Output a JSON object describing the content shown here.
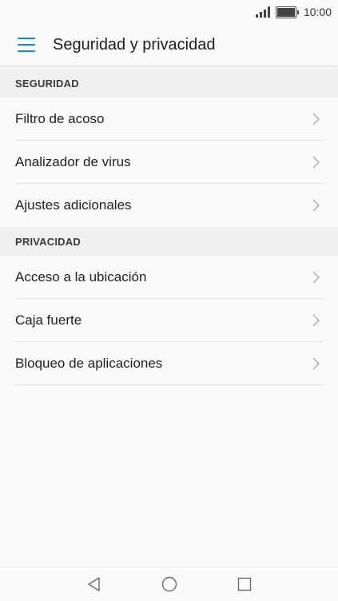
{
  "status_bar": {
    "time": "10:00",
    "signal_icon": "signal-icon",
    "battery_icon": "battery-icon",
    "battery_level": 1.0
  },
  "app_bar": {
    "menu_icon": "hamburger-menu-icon",
    "title": "Seguridad y privacidad",
    "accent_color": "#1a82e0"
  },
  "sections": [
    {
      "header": "SEGURIDAD",
      "items": [
        {
          "label": "Filtro de acoso"
        },
        {
          "label": "Analizador de virus"
        },
        {
          "label": "Ajustes adicionales"
        }
      ]
    },
    {
      "header": "PRIVACIDAD",
      "items": [
        {
          "label": "Acceso a la ubicación"
        },
        {
          "label": "Caja fuerte"
        },
        {
          "label": "Bloqueo de aplicaciones"
        }
      ]
    }
  ],
  "nav_bar": {
    "back_icon": "back-triangle-icon",
    "home_icon": "home-circle-icon",
    "recents_icon": "recents-square-icon"
  }
}
